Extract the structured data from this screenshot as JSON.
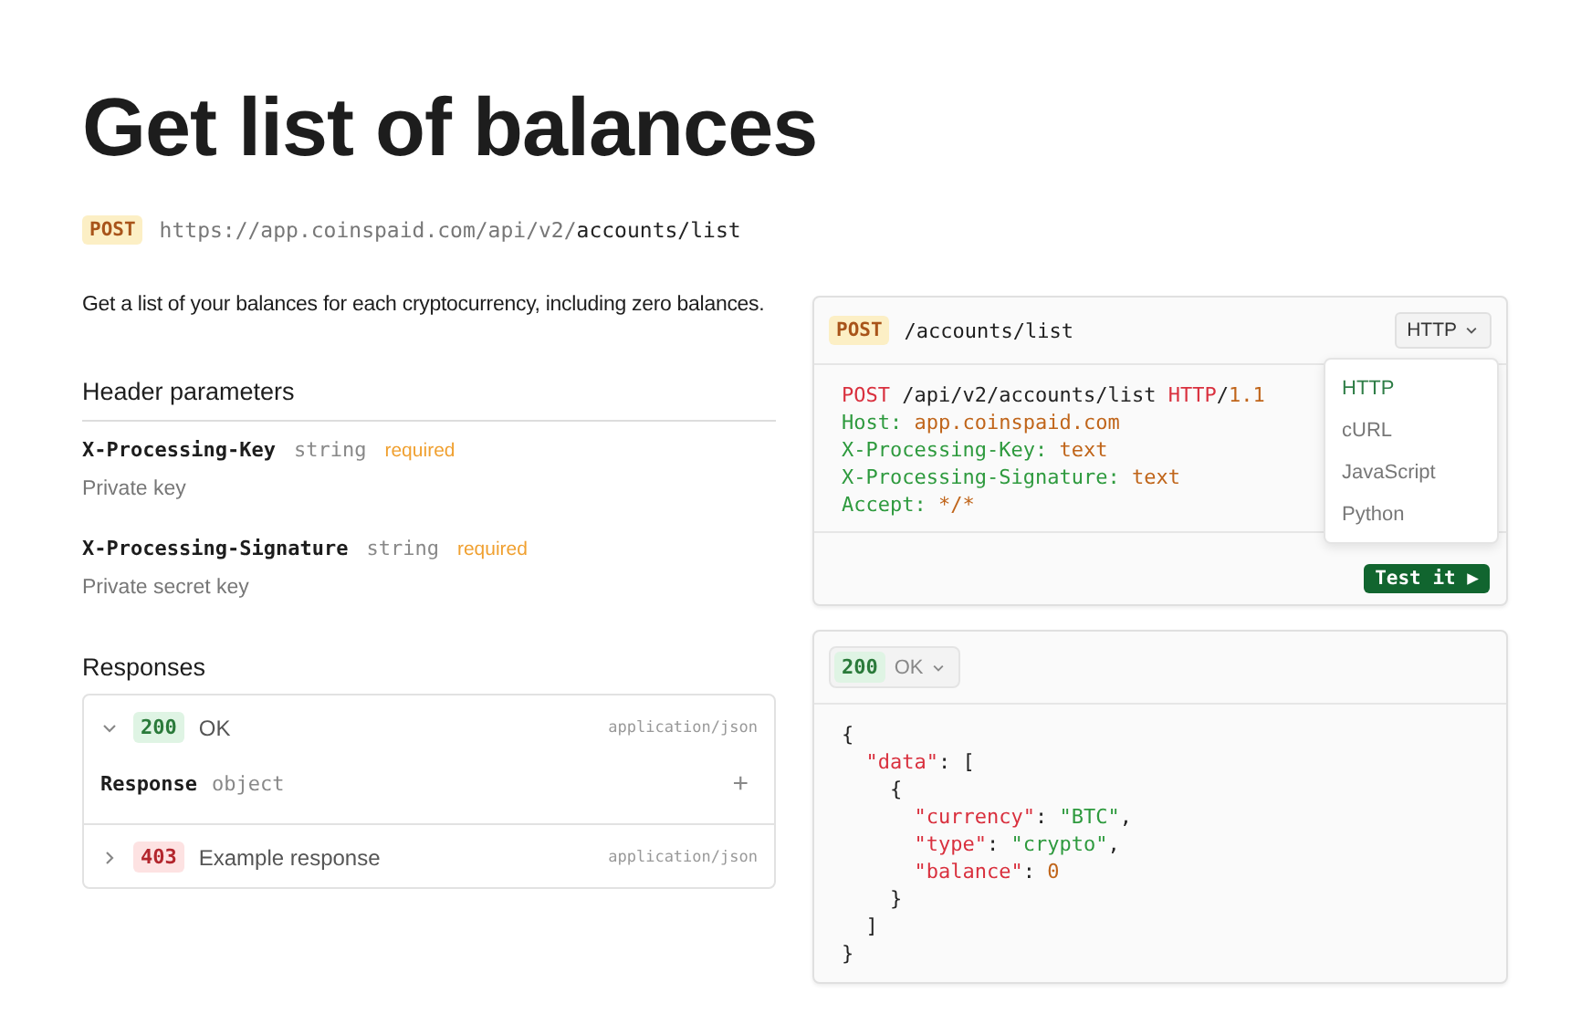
{
  "title": "Get list of balances",
  "endpoint": {
    "method": "POST",
    "base": "https://app.coinspaid.com/api/v2/",
    "path": "accounts/list"
  },
  "description": "Get a list of your balances for each cryptocurrency, including zero balances.",
  "header_parameters": {
    "heading": "Header parameters",
    "params": [
      {
        "name": "X-Processing-Key",
        "type": "string",
        "required": "required",
        "description": "Private key"
      },
      {
        "name": "X-Processing-Signature",
        "type": "string",
        "required": "required",
        "description": "Private secret key"
      }
    ]
  },
  "responses": {
    "heading": "Responses",
    "items": [
      {
        "code": "200",
        "kind": "success",
        "label": "OK",
        "media": "application/json",
        "expanded": true,
        "field": {
          "name": "Response",
          "type": "object",
          "toggle": "+"
        }
      },
      {
        "code": "403",
        "kind": "error",
        "label": "Example response",
        "media": "application/json",
        "expanded": false
      }
    ]
  },
  "request_sample": {
    "method": "POST",
    "path": "/accounts/list",
    "language": "HTTP",
    "lines": [
      [
        {
          "kind": "method",
          "t": "POST"
        },
        {
          "kind": "plain",
          "t": " /api/v2/accounts/list "
        },
        {
          "kind": "method",
          "t": "HTTP"
        },
        {
          "kind": "plain",
          "t": "/"
        },
        {
          "kind": "value",
          "t": "1.1"
        }
      ],
      [
        {
          "kind": "key",
          "t": "Host: "
        },
        {
          "kind": "value",
          "t": "app.coinspaid.com"
        }
      ],
      [
        {
          "kind": "key",
          "t": "X-Processing-Key: "
        },
        {
          "kind": "value",
          "t": "text"
        }
      ],
      [
        {
          "kind": "key",
          "t": "X-Processing-Signature: "
        },
        {
          "kind": "value",
          "t": "text"
        }
      ],
      [
        {
          "kind": "key",
          "t": "Accept: "
        },
        {
          "kind": "value",
          "t": "*/*"
        }
      ]
    ],
    "test_button": "Test it ▶",
    "menu": [
      {
        "label": "HTTP",
        "selected": true
      },
      {
        "label": "cURL",
        "selected": false
      },
      {
        "label": "JavaScript",
        "selected": false
      },
      {
        "label": "Python",
        "selected": false
      }
    ]
  },
  "response_sample": {
    "code": "200",
    "label": "OK",
    "lines": [
      [
        {
          "kind": "plain",
          "t": "{"
        }
      ],
      [
        {
          "kind": "method",
          "t": "  \"data\""
        },
        {
          "kind": "plain",
          "t": ": ["
        }
      ],
      [
        {
          "kind": "plain",
          "t": "    {"
        }
      ],
      [
        {
          "kind": "method",
          "t": "      \"currency\""
        },
        {
          "kind": "plain",
          "t": ": "
        },
        {
          "kind": "string",
          "t": "\"BTC\""
        },
        {
          "kind": "plain",
          "t": ","
        }
      ],
      [
        {
          "kind": "method",
          "t": "      \"type\""
        },
        {
          "kind": "plain",
          "t": ": "
        },
        {
          "kind": "string",
          "t": "\"crypto\""
        },
        {
          "kind": "plain",
          "t": ","
        }
      ],
      [
        {
          "kind": "method",
          "t": "      \"balance\""
        },
        {
          "kind": "plain",
          "t": ": "
        },
        {
          "kind": "value",
          "t": "0"
        }
      ],
      [
        {
          "kind": "plain",
          "t": "    }"
        }
      ],
      [
        {
          "kind": "plain",
          "t": "  ]"
        }
      ],
      [
        {
          "kind": "plain",
          "t": "}"
        }
      ]
    ]
  }
}
